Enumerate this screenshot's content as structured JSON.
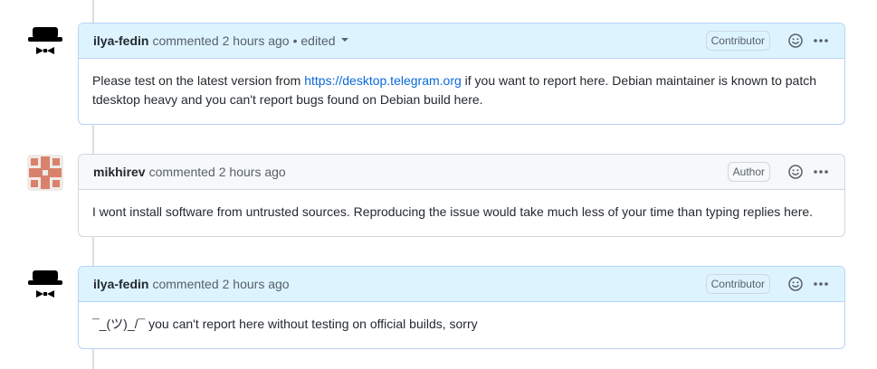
{
  "comments": [
    {
      "author": "ilya-fedin",
      "action": "commented",
      "time": "2 hours ago",
      "edited": "• edited",
      "badge": "Contributor",
      "body_before": "Please test on the latest version from ",
      "link": "https://desktop.telegram.org",
      "body_after": " if you want to report here. Debian maintainer is known to patch tdesktop heavy and you can't report bugs found on Debian build here."
    },
    {
      "author": "mikhirev",
      "action": "commented",
      "time": "2 hours ago",
      "badge": "Author",
      "body": "I wont install software from untrusted sources. Reproducing the issue would take much less of your time than typing replies here."
    },
    {
      "author": "ilya-fedin",
      "action": "commented",
      "time": "2 hours ago",
      "badge": "Contributor",
      "body": "¯_(ツ)_/¯ you can't report here without testing on official builds, sorry"
    }
  ],
  "colors": {
    "accent_link": "#0969da",
    "header_blue": "#ddf4ff",
    "header_gray": "#f6f8fa",
    "border": "#d0d7de",
    "avatar_red": "#d9826b"
  },
  "icons": {
    "reaction": "smiley-icon",
    "more": "kebab-horizontal-icon",
    "edited_menu": "triangle-down-icon"
  }
}
